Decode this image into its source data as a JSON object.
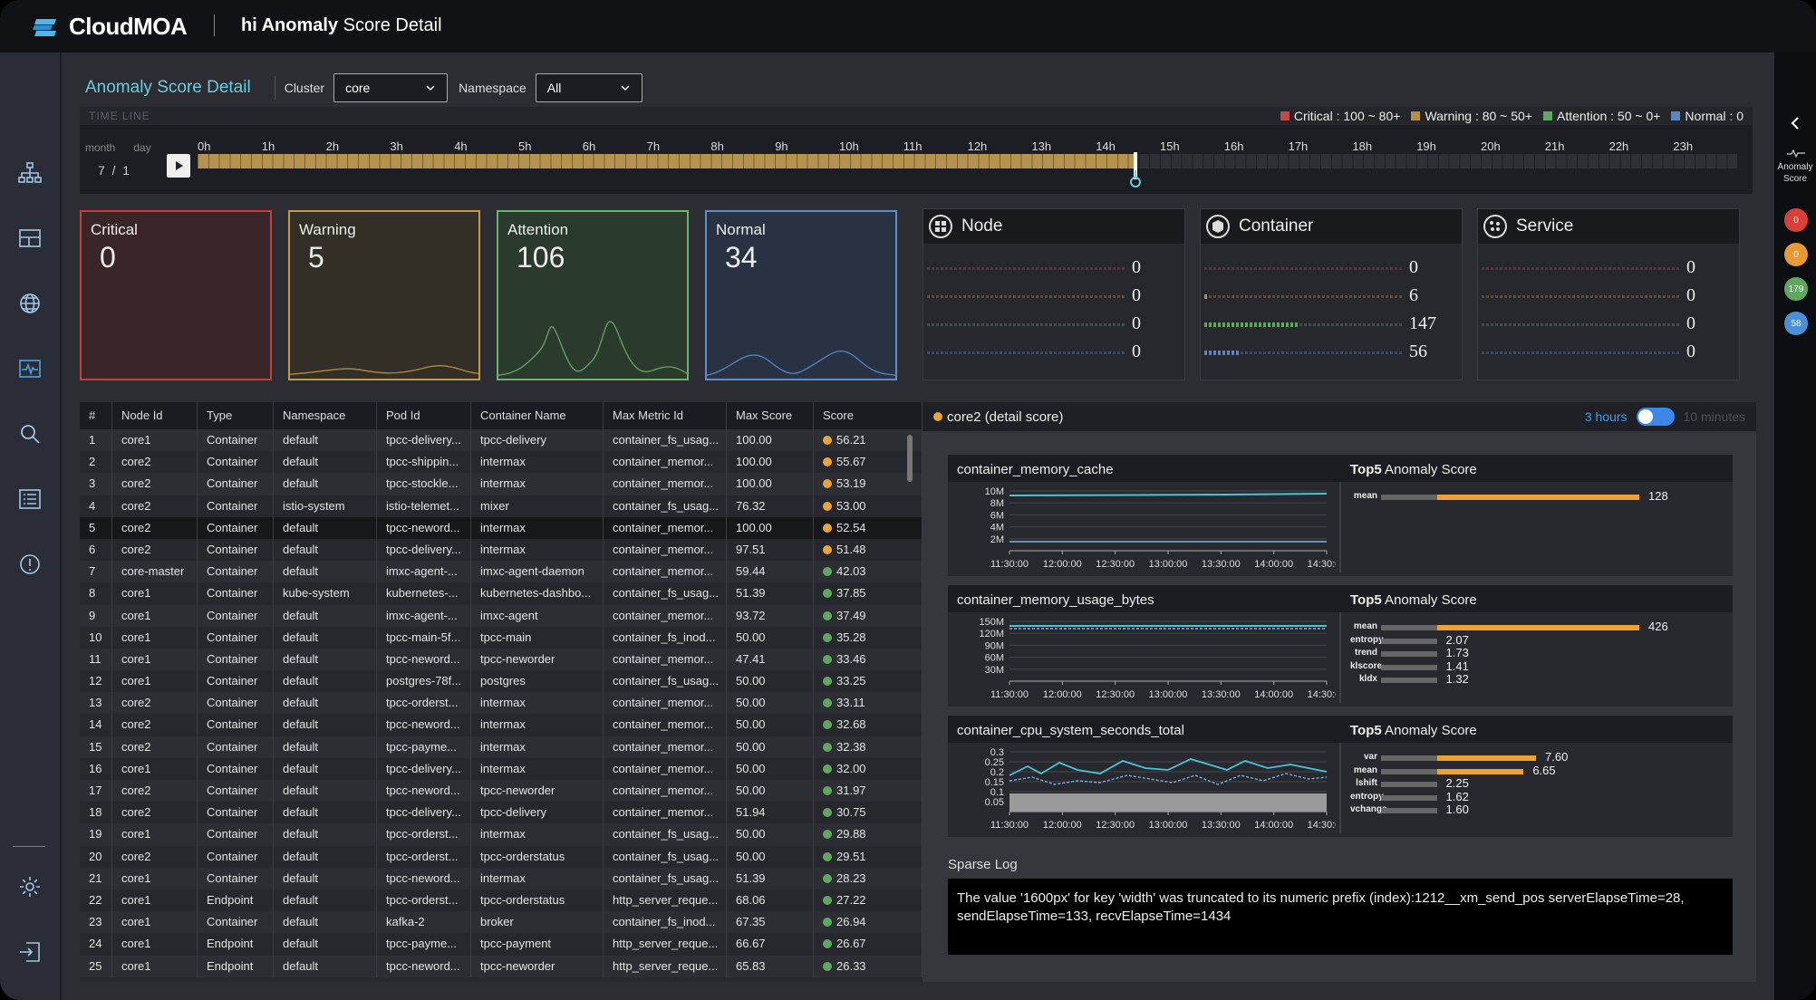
{
  "app": {
    "brand": "CloudMOA",
    "title_bold": "hi Anomaly",
    "title_rest": " Score Detail"
  },
  "page": {
    "title": "Anomaly Score Detail"
  },
  "filters": {
    "cluster_label": "Cluster",
    "cluster_value": "core",
    "namespace_label": "Namespace",
    "namespace_value": "All"
  },
  "timeline": {
    "label": "TIME LINE",
    "month_label": "month",
    "day_label": "day",
    "month": "7",
    "sep": "/",
    "day": "1",
    "hours": [
      "0h",
      "1h",
      "2h",
      "3h",
      "4h",
      "5h",
      "6h",
      "7h",
      "8h",
      "9h",
      "10h",
      "11h",
      "12h",
      "13h",
      "14h",
      "15h",
      "16h",
      "17h",
      "18h",
      "19h",
      "20h",
      "21h",
      "22h",
      "23h"
    ],
    "progress": 0.609,
    "legend": [
      {
        "label": "Critical : 100 ~ 80+",
        "color": "#c24a44"
      },
      {
        "label": "Warning : 80 ~ 50+",
        "color": "#b88e47"
      },
      {
        "label": "Attention : 50 ~ 0+",
        "color": "#5fa860"
      },
      {
        "label": "Normal : 0",
        "color": "#5a86c2"
      }
    ]
  },
  "status_cards": [
    {
      "label": "Critical",
      "value": "0",
      "border": "#c2413c",
      "bg": "#3a2628"
    },
    {
      "label": "Warning",
      "value": "5",
      "border": "#c59a44",
      "bg": "#332e26"
    },
    {
      "label": "Attention",
      "value": "106",
      "border": "#69b66a",
      "bg": "#2a3a2c"
    },
    {
      "label": "Normal",
      "value": "34",
      "border": "#5c8ed0",
      "bg": "#283242"
    }
  ],
  "resource_cards": [
    {
      "label": "Node",
      "icon": "grid-icon",
      "rows": [
        {
          "value": "0",
          "fill": 0
        },
        {
          "value": "0",
          "fill": 0
        },
        {
          "value": "0",
          "fill": 0
        },
        {
          "value": "0",
          "fill": 0
        }
      ]
    },
    {
      "label": "Container",
      "icon": "cube-icon",
      "rows": [
        {
          "value": "0",
          "fill": 0
        },
        {
          "value": "6",
          "fill": 0.02
        },
        {
          "value": "147",
          "fill": 0.48
        },
        {
          "value": "56",
          "fill": 0.18
        }
      ]
    },
    {
      "label": "Service",
      "icon": "nodes-icon",
      "rows": [
        {
          "value": "0",
          "fill": 0
        },
        {
          "value": "0",
          "fill": 0
        },
        {
          "value": "0",
          "fill": 0
        },
        {
          "value": "0",
          "fill": 0
        }
      ]
    }
  ],
  "table": {
    "headers": [
      "#",
      "Node Id",
      "Type",
      "Namespace",
      "Pod Id",
      "Container Name",
      "Max Metric Id",
      "Max Score",
      "Score"
    ],
    "rows": [
      [
        "1",
        "core1",
        "Container",
        "default",
        "tpcc-delivery...",
        "tpcc-delivery",
        "container_fs_usag...",
        "100.00",
        "56.21",
        "w"
      ],
      [
        "2",
        "core2",
        "Container",
        "default",
        "tpcc-shippin...",
        "intermax",
        "container_memor...",
        "100.00",
        "55.67",
        "w"
      ],
      [
        "3",
        "core2",
        "Container",
        "default",
        "tpcc-stockle...",
        "intermax",
        "container_memor...",
        "100.00",
        "53.19",
        "w"
      ],
      [
        "4",
        "core2",
        "Container",
        "istio-system",
        "istio-telemet...",
        "mixer",
        "container_fs_usag...",
        "76.32",
        "53.00",
        "w"
      ],
      [
        "5",
        "core2",
        "Container",
        "default",
        "tpcc-neword...",
        "intermax",
        "container_memor...",
        "100.00",
        "52.54",
        "w"
      ],
      [
        "6",
        "core2",
        "Container",
        "default",
        "tpcc-delivery...",
        "intermax",
        "container_memor...",
        "97.51",
        "51.48",
        "w"
      ],
      [
        "7",
        "core-master",
        "Container",
        "default",
        "imxc-agent-...",
        "imxc-agent-daemon",
        "container_memor...",
        "59.44",
        "42.03",
        "a"
      ],
      [
        "8",
        "core1",
        "Container",
        "kube-system",
        "kubernetes-...",
        "kubernetes-dashbo...",
        "container_fs_usag...",
        "51.39",
        "37.85",
        "a"
      ],
      [
        "9",
        "core1",
        "Container",
        "default",
        "imxc-agent-...",
        "imxc-agent",
        "container_memor...",
        "93.72",
        "37.49",
        "a"
      ],
      [
        "10",
        "core1",
        "Container",
        "default",
        "tpcc-main-5f...",
        "tpcc-main",
        "container_fs_inod...",
        "50.00",
        "35.28",
        "a"
      ],
      [
        "11",
        "core1",
        "Container",
        "default",
        "tpcc-neword...",
        "tpcc-neworder",
        "container_memor...",
        "47.41",
        "33.46",
        "a"
      ],
      [
        "12",
        "core1",
        "Container",
        "default",
        "postgres-78f...",
        "postgres",
        "container_fs_usag...",
        "50.00",
        "33.25",
        "a"
      ],
      [
        "13",
        "core2",
        "Container",
        "default",
        "tpcc-orderst...",
        "intermax",
        "container_memor...",
        "50.00",
        "33.11",
        "a"
      ],
      [
        "14",
        "core2",
        "Container",
        "default",
        "tpcc-neword...",
        "intermax",
        "container_memor...",
        "50.00",
        "32.68",
        "a"
      ],
      [
        "15",
        "core2",
        "Container",
        "default",
        "tpcc-payme...",
        "intermax",
        "container_memor...",
        "50.00",
        "32.38",
        "a"
      ],
      [
        "16",
        "core1",
        "Container",
        "default",
        "tpcc-delivery...",
        "intermax",
        "container_memor...",
        "50.00",
        "32.00",
        "a"
      ],
      [
        "17",
        "core2",
        "Container",
        "default",
        "tpcc-neword...",
        "tpcc-neworder",
        "container_memor...",
        "50.00",
        "31.97",
        "a"
      ],
      [
        "18",
        "core2",
        "Container",
        "default",
        "tpcc-delivery...",
        "tpcc-delivery",
        "container_memor...",
        "51.94",
        "30.75",
        "a"
      ],
      [
        "19",
        "core1",
        "Container",
        "default",
        "tpcc-orderst...",
        "intermax",
        "container_fs_usag...",
        "50.00",
        "29.88",
        "a"
      ],
      [
        "20",
        "core2",
        "Container",
        "default",
        "tpcc-orderst...",
        "tpcc-orderstatus",
        "container_fs_usag...",
        "50.00",
        "29.51",
        "a"
      ],
      [
        "21",
        "core1",
        "Container",
        "default",
        "tpcc-neword...",
        "intermax",
        "container_fs_usag...",
        "51.39",
        "28.23",
        "a"
      ],
      [
        "22",
        "core1",
        "Endpoint",
        "default",
        "tpcc-orderst...",
        "tpcc-orderstatus",
        "http_server_reque...",
        "68.06",
        "27.22",
        "a"
      ],
      [
        "23",
        "core1",
        "Container",
        "default",
        "kafka-2",
        "broker",
        "container_fs_inod...",
        "67.35",
        "26.94",
        "a"
      ],
      [
        "24",
        "core1",
        "Endpoint",
        "default",
        "tpcc-payme...",
        "tpcc-payment",
        "http_server_reque...",
        "66.67",
        "26.67",
        "a"
      ],
      [
        "25",
        "core1",
        "Endpoint",
        "default",
        "tpcc-neword...",
        "tpcc-neworder",
        "http_server_reque...",
        "65.83",
        "26.33",
        "a"
      ]
    ]
  },
  "detail": {
    "title": "core2 (detail score)",
    "toggle_left": "3 hours",
    "toggle_right": "10 minutes",
    "top5_bold": "Top5",
    "top5_rest": " Anomaly Score",
    "x_ticks": [
      "11:30:00",
      "12:00:00",
      "12:30:00",
      "13:00:00",
      "13:30:00",
      "14:00:00",
      "14:30:00"
    ],
    "panels": [
      {
        "metric": "container_memory_cache",
        "y_ticks": [
          "10M",
          "8M",
          "6M",
          "4M",
          "2M"
        ],
        "scores": [
          {
            "name": "mean",
            "value": "128",
            "fill": 0.98,
            "track": 0.27
          }
        ]
      },
      {
        "metric": "container_memory_usage_bytes",
        "y_ticks": [
          "150M",
          "120M",
          "90M",
          "60M",
          "30M"
        ],
        "scores": [
          {
            "name": "mean",
            "value": "426",
            "fill": 0.98,
            "track": 0.27
          },
          {
            "name": "entropy",
            "value": "2.07",
            "fill": 0,
            "track": 0.27
          },
          {
            "name": "trend",
            "value": "1.73",
            "fill": 0,
            "track": 0.27
          },
          {
            "name": "klscore",
            "value": "1.41",
            "fill": 0,
            "track": 0.27
          },
          {
            "name": "kldx",
            "value": "1.32",
            "fill": 0,
            "track": 0.27
          }
        ]
      },
      {
        "metric": "container_cpu_system_seconds_total",
        "y_ticks": [
          "0.3",
          "0.25",
          "0.2",
          "0.15",
          "0.1",
          "0.05"
        ],
        "scores": [
          {
            "name": "var",
            "value": "7.60",
            "fill": 0.48,
            "track": 0.27
          },
          {
            "name": "mean",
            "value": "6.65",
            "fill": 0.42,
            "track": 0.27
          },
          {
            "name": "lshift",
            "value": "2.25",
            "fill": 0,
            "track": 0.27
          },
          {
            "name": "entropy",
            "value": "1.62",
            "fill": 0,
            "track": 0.27
          },
          {
            "name": "vchange",
            "value": "1.60",
            "fill": 0,
            "track": 0.27
          }
        ]
      }
    ],
    "sparse_title": "Sparse Log",
    "sparse_text": "The value '1600px' for key 'width' was truncated to its numeric prefix (index):1212__xm_send_pos serverElapseTime=28, sendElapseTime=133, recvElapseTime=1434"
  },
  "right_rail": {
    "label": "Anomaly Score",
    "badges": [
      {
        "value": "0",
        "color": "#d9403a"
      },
      {
        "value": "0",
        "color": "#e59a35"
      },
      {
        "value": "179",
        "color": "#5fa860"
      },
      {
        "value": "58",
        "color": "#4b8fd8"
      }
    ]
  },
  "nav": [
    "topology-icon",
    "dashboard-icon",
    "globe-icon",
    "anomaly-icon",
    "search-icon",
    "list-icon",
    "alert-icon",
    "settings-icon",
    "logout-icon"
  ],
  "colors": {
    "warning": "#e9a339",
    "attention": "#5fa860",
    "accent": "#6ccbdc"
  }
}
